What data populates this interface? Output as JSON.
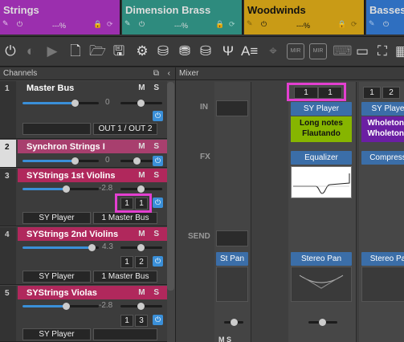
{
  "tabs": [
    {
      "name": "Strings",
      "level": "---%",
      "color": "#9b2fae"
    },
    {
      "name": "Dimension Brass",
      "level": "---%",
      "color": "#2e8b7e"
    },
    {
      "name": "Woodwinds",
      "level": "---%",
      "color": "#c99b16"
    },
    {
      "name": "Basses",
      "level": "",
      "color": "#2f6fc0"
    }
  ],
  "toolbar": {
    "icons": [
      "power-icon",
      "back-icon",
      "play-icon",
      "new-file-icon",
      "open-folder-icon",
      "save-icon",
      "settings-icon",
      "db-icon",
      "db-stack-icon",
      "db-r-icon",
      "tuning-fork-icon",
      "text-a-icon",
      "crosshair-icon",
      "mir-icon",
      "mir-x-icon",
      "keyboard-icon",
      "window-icon",
      "fullscreen-icon",
      "grid-icon"
    ],
    "mir1": "MIR",
    "mir2": "MIR"
  },
  "channels_panel": {
    "title": "Channels",
    "items": [
      {
        "num": "1",
        "title": "Master Bus",
        "value": "0",
        "output": "OUT 1 / OUT 2"
      },
      {
        "num": "2",
        "title": "Synchron Strings I",
        "value": "0"
      },
      {
        "num": "3",
        "title": "SYStrings 1st Violins",
        "value": "-2.8",
        "in1": "1",
        "in2": "1",
        "player": "SY Player",
        "bus": "1 Master Bus"
      },
      {
        "num": "4",
        "title": "SYStrings 2nd Violins",
        "value": "4.3",
        "in1": "1",
        "in2": "2",
        "player": "SY Player",
        "bus": "1 Master Bus"
      },
      {
        "num": "5",
        "title": "SYStrings Violas",
        "value": "-2.8",
        "in1": "1",
        "in2": "3",
        "player": "SY Player"
      }
    ],
    "ms": "M S"
  },
  "mixer": {
    "title": "Mixer",
    "in_label": "IN",
    "fx_label": "FX",
    "send_label": "SEND",
    "strips": [
      {
        "in1": "1",
        "in2": "1",
        "plugin": "SY Player",
        "patch1": "Long notes",
        "patch2": "Flautando",
        "fx": "Equalizer",
        "pan": "Stereo Pan"
      },
      {
        "in1": "1",
        "in2": "2",
        "plugin": "SY Playe",
        "patch1": "Wholetone",
        "patch2": "Wholetone",
        "fx": "Compress",
        "pan": "Stereo Pa"
      }
    ],
    "st_pan": "St Pan",
    "ms_bottom": "M S"
  }
}
